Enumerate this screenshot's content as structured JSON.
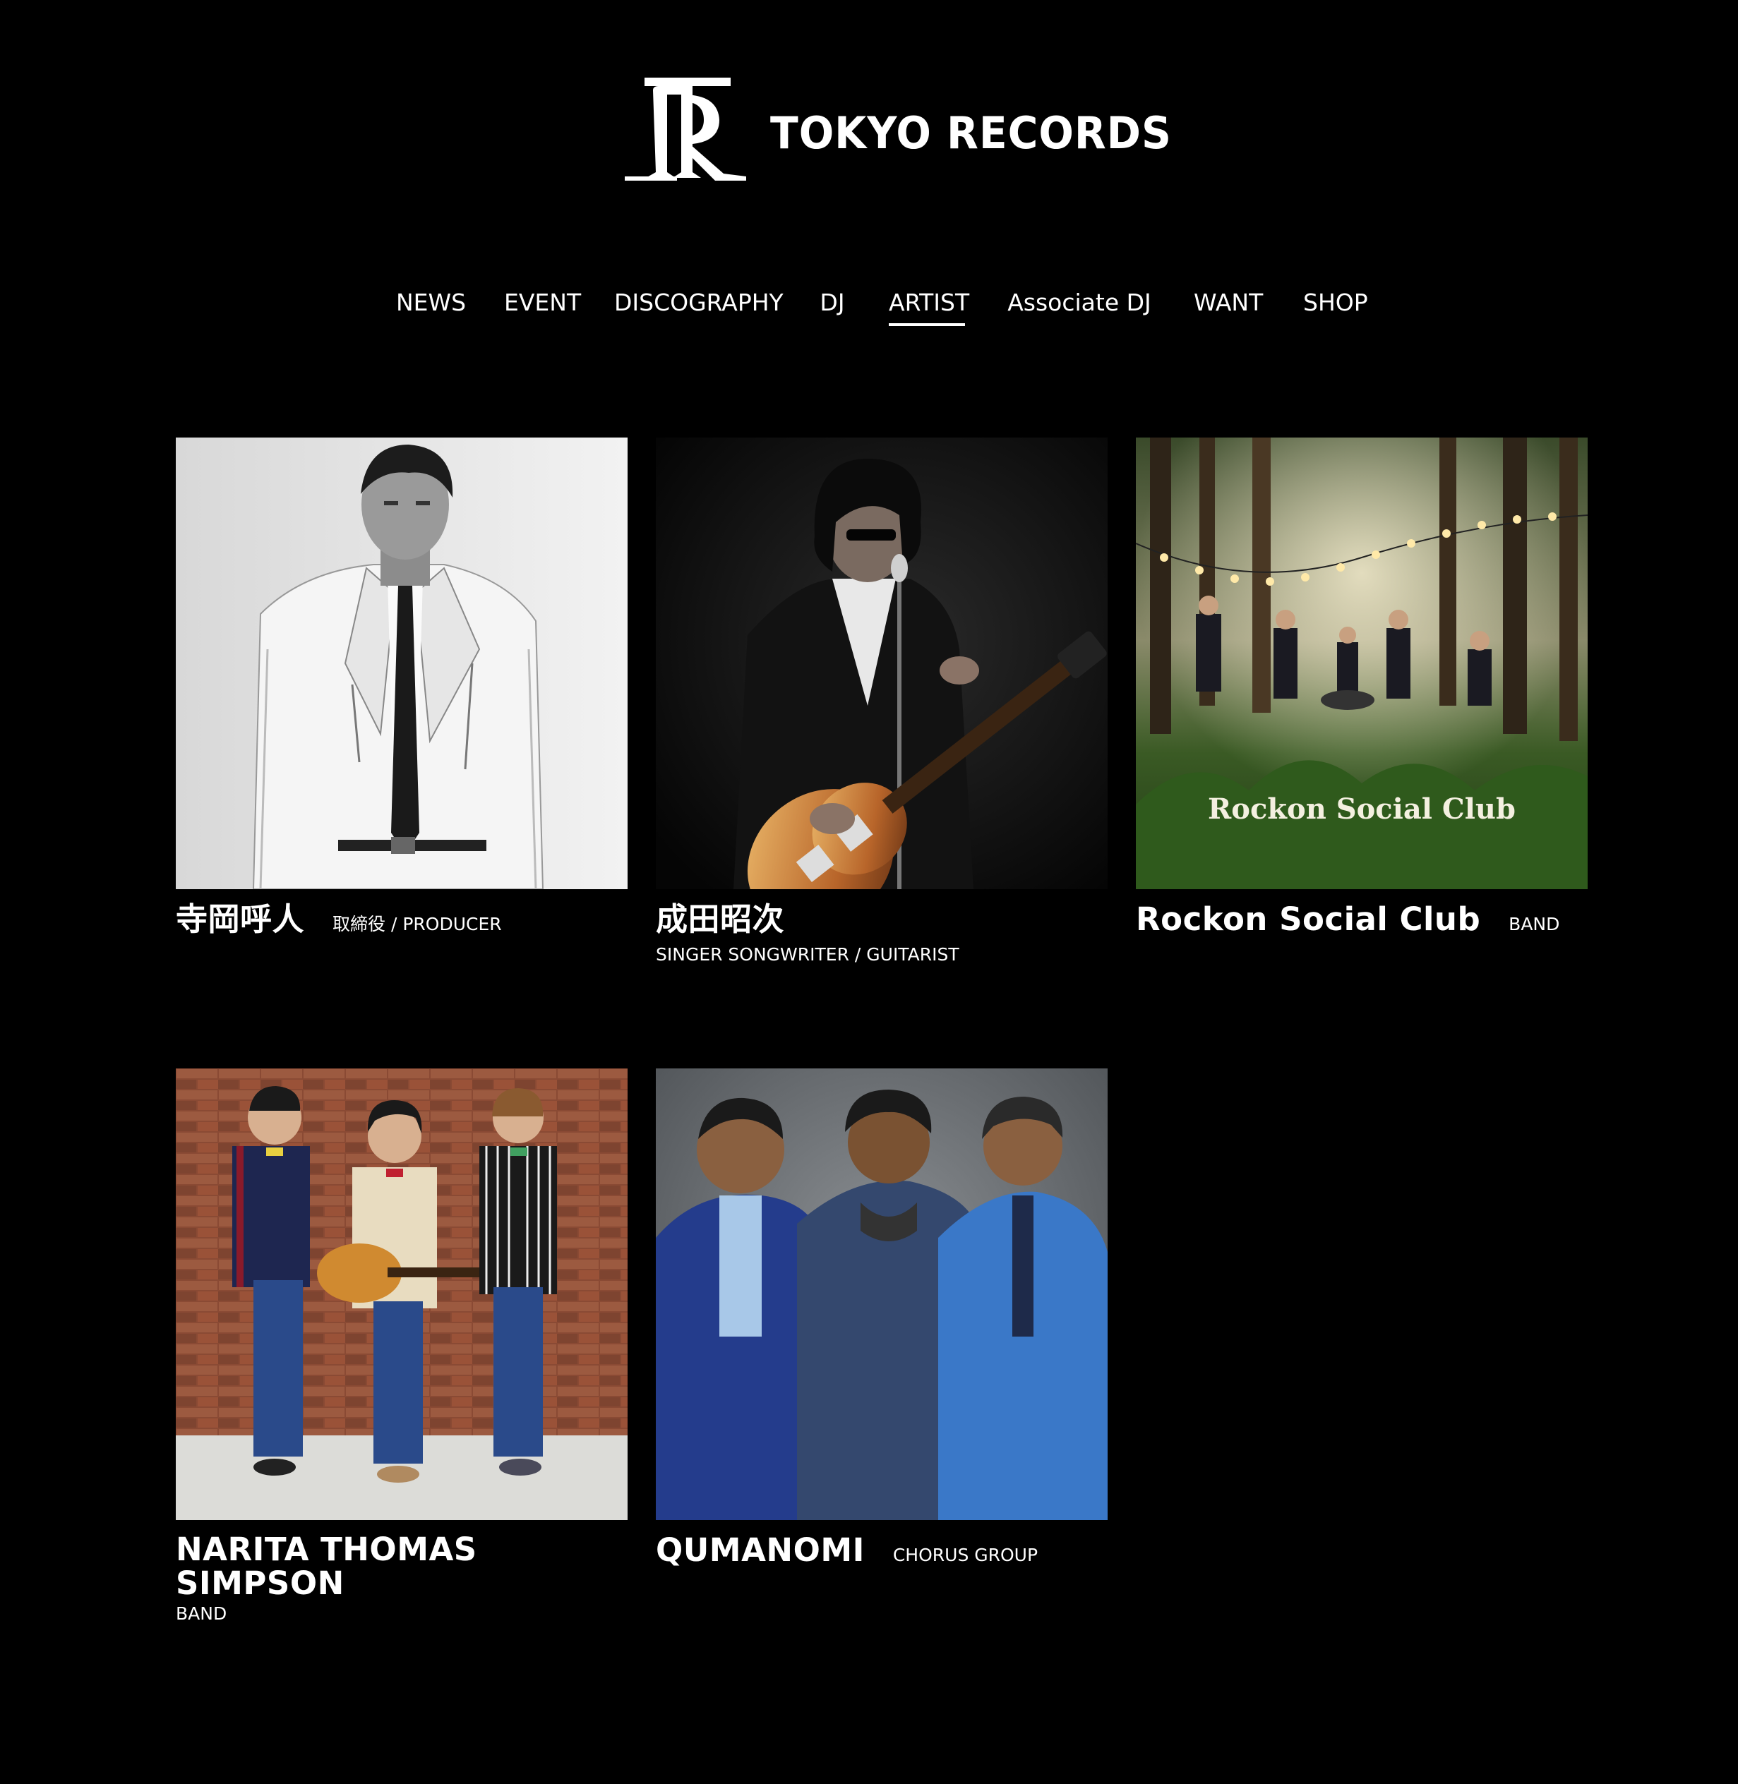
{
  "brand": {
    "name": "TOKYO RECORDS",
    "logo_icon": "tr-monogram-logo"
  },
  "nav": {
    "items": [
      {
        "label": "NEWS"
      },
      {
        "label": "EVENT"
      },
      {
        "label": "DISCOGRAPHY"
      },
      {
        "label": "DJ"
      },
      {
        "label": "ARTIST",
        "active": true
      },
      {
        "label": "Associate DJ"
      },
      {
        "label": "WANT"
      },
      {
        "label": "SHOP"
      }
    ]
  },
  "artists": [
    {
      "name": "寺岡呼人",
      "role": "取締役 / PRODUCER",
      "photo": "portrait of man in white leather jacket (black & white)"
    },
    {
      "name": "成田昭次",
      "role": "SINGER SONGWRITER / GUITARIST",
      "photo": "guitarist with sunburst electric guitar on dark stage"
    },
    {
      "name": "Rockon Social Club",
      "role": "BAND",
      "photo": "band performing in a forest with string lights",
      "photo_text": "Rockon Social Club"
    },
    {
      "name": "NARITA THOMAS SIMPSON",
      "role": "BAND",
      "photo": "three men in blazers against brick wall"
    },
    {
      "name": "QUMANOMI",
      "role": "CHORUS GROUP",
      "photo": "three men in blue denim outfits on grey backdrop"
    }
  ],
  "colors": {
    "background": "#000000",
    "text": "#ffffff"
  }
}
